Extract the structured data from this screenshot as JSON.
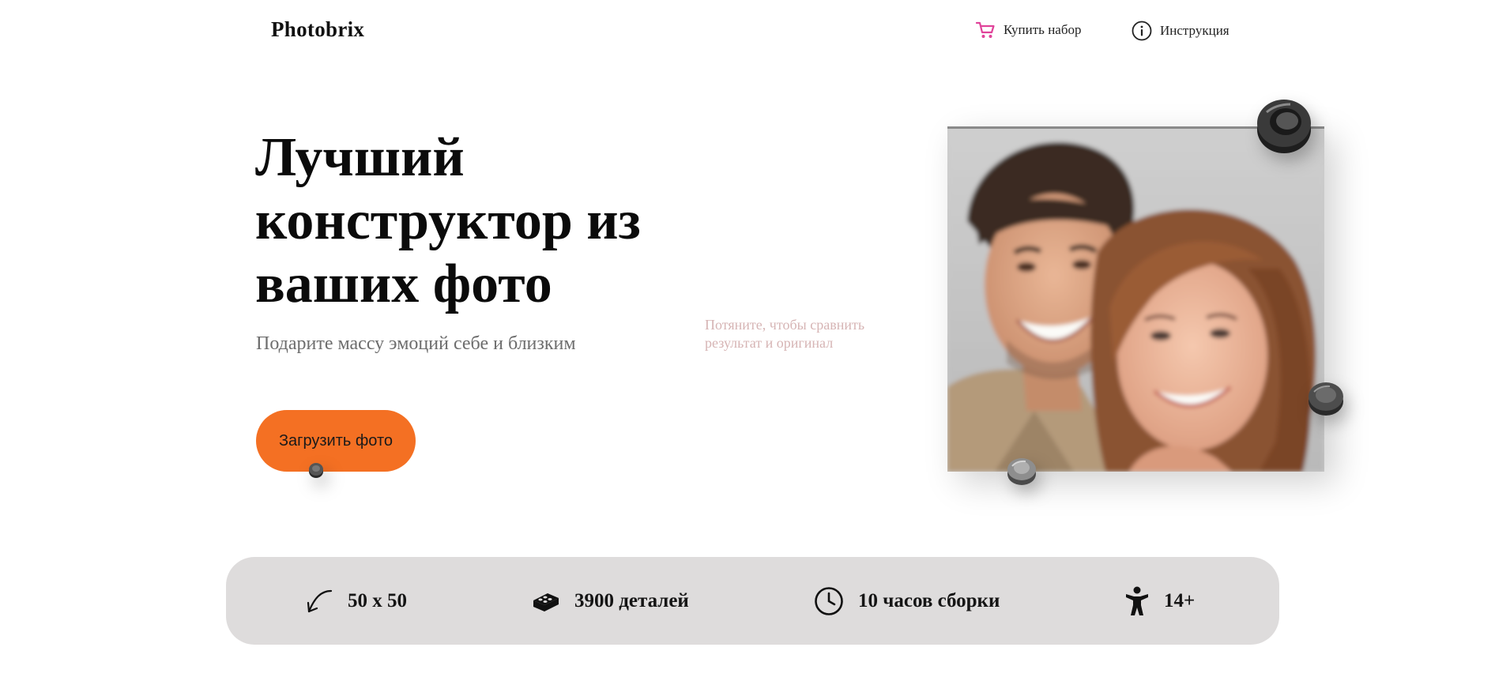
{
  "header": {
    "logo": "Photobrix",
    "nav": {
      "buy_label": "Купить набор",
      "guide_label": "Инструкция"
    }
  },
  "hero": {
    "title": "Лучший конструктор из ваших фото",
    "subtitle": "Подарите массу эмоций себе и близким",
    "upload_label": "Загрузить фото",
    "compare_hint": "Потяните, чтобы сравнить результат и оригинал"
  },
  "stats": {
    "size": "50 x 50",
    "parts": "3900 деталей",
    "time": "10 часов сборки",
    "age": "14+"
  },
  "icons": {
    "cart": "cart-icon",
    "info": "info-icon",
    "size": "diagonal-arrow-icon",
    "parts": "lego-brick-icon",
    "time": "clock-icon",
    "age": "person-icon"
  },
  "colors": {
    "accent": "#f47023",
    "cart_icon": "#e0439a",
    "stats_background": "#dedcdc",
    "hint_text": "#d6b4b4",
    "subtitle_text": "#6d6d6d"
  }
}
